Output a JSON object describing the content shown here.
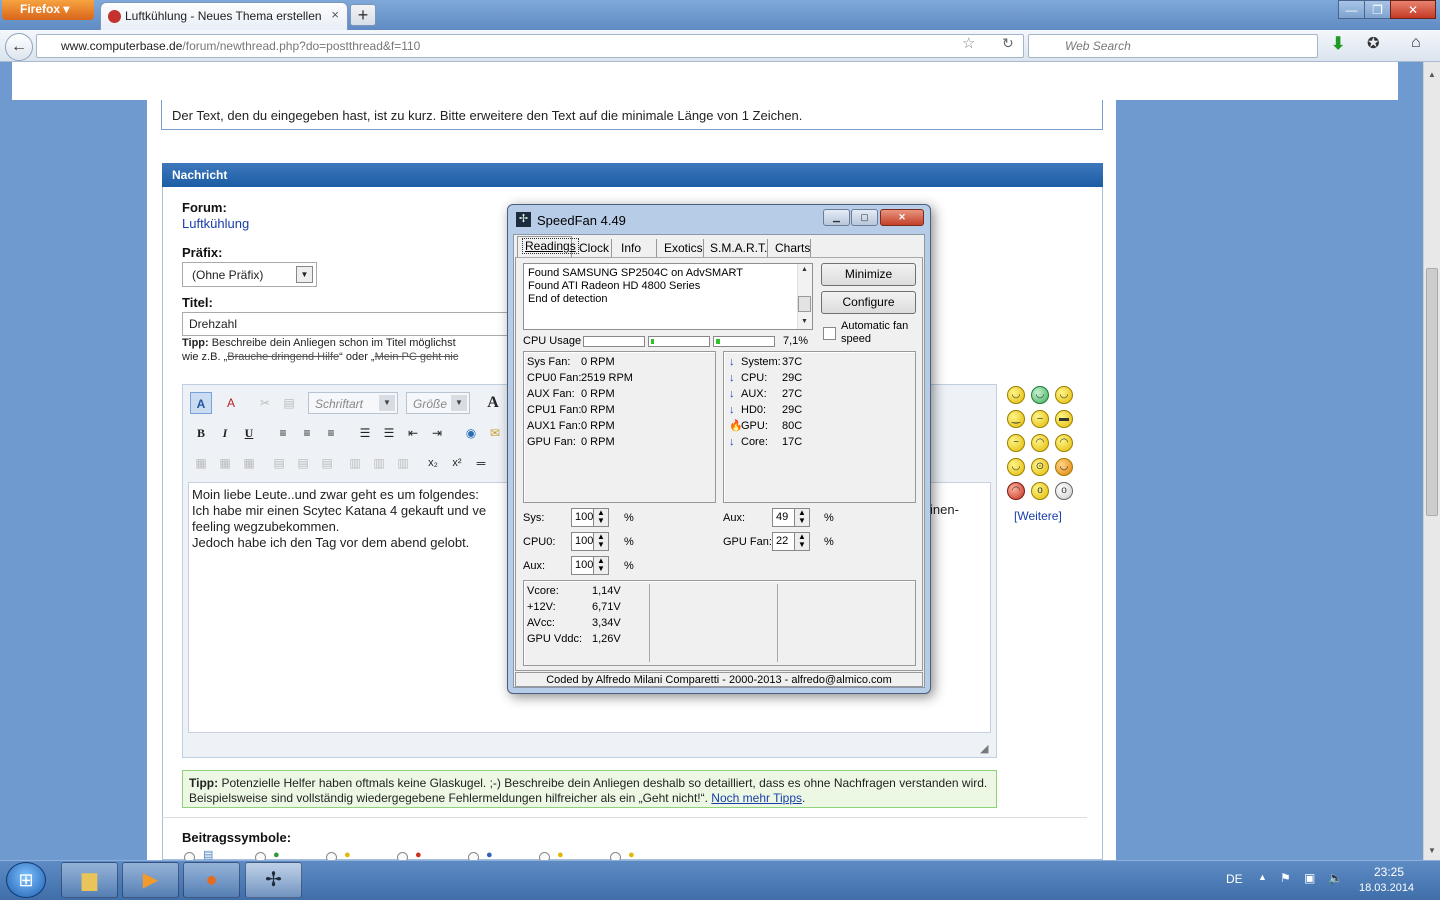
{
  "browser": {
    "menu_button": "Firefox ▾",
    "tab_title": "Luftkühlung - Neues Thema erstellen",
    "tab_close": "×",
    "new_tab": "+",
    "url_domain": "www.computerbase.de",
    "url_path": "/forum/newthread.php?do=postthread&f=110",
    "search_placeholder": "Web Search",
    "win_min": "—",
    "win_max": "❐",
    "win_close": "✕"
  },
  "page": {
    "error_text": "Der Text, den du eingegeben hast, ist zu kurz. Bitte erweitere den Text auf die minimale Länge von 1 Zeichen.",
    "section_title": "Nachricht",
    "forum_label": "Forum:",
    "forum_value": "Luftkühlung",
    "prefix_label": "Präfix:",
    "prefix_value": "(Ohne Präfix)",
    "title_label": "Titel:",
    "title_value": "Drehzahl",
    "tipp1_bold": "Tipp:",
    "tipp1_text": "Beschreibe dein Anliegen schon im Titel möglichst",
    "tipp1_line2_start": "wie z.B. „",
    "tipp1_strike1": "Brauche dringend Hilfe",
    "tipp1_mid": "“ oder „",
    "tipp1_strike2": "Mein PC geht nic",
    "font_select": "Schriftart",
    "size_select": "Größe",
    "editor_lines": [
      "Moin liebe Leute..und zwar geht es um folgendes:",
      "Ich habe mir einen Scytec Katana 4 gekauft und ve",
      "feeling wegzubekommen.",
      "Jedoch habe ich den Tag vor dem abend gelobt."
    ],
    "editor_overflow": "inen-",
    "weitere": "[Weitere]",
    "tipp2_bold": "Tipp:",
    "tipp2_text": "Potenzielle Helfer haben oftmals keine Glaskugel. ;-) Beschreibe dein Anliegen deshalb so detailliert, dass es ohne Nachfragen verstanden wird. Beispielsweise sind vollständig wiedergegebene Fehlermeldungen hilfreicher als ein „Geht nicht!“.",
    "tipp2_link": "Noch mehr Tipps",
    "tipp2_end": ".",
    "beitrag_label": "Beitragssymbole:"
  },
  "speedfan": {
    "title": "SpeedFan 4.49",
    "tabs": [
      "Readings",
      "Clock",
      "Info",
      "Exotics",
      "S.M.A.R.T.",
      "Charts"
    ],
    "log": [
      "Found SAMSUNG SP2504C on AdvSMART",
      "Found ATI Radeon HD 4800 Series",
      "End of detection"
    ],
    "btn_minimize": "Minimize",
    "btn_configure": "Configure",
    "auto_fan": "Automatic fan speed",
    "cpu_usage_label": "CPU Usage",
    "cpu_usage_value": "7,1%",
    "cpu_bars": [
      0.0,
      0.06,
      0.08
    ],
    "fans": [
      {
        "name": "Sys Fan:",
        "value": "0 RPM"
      },
      {
        "name": "CPU0 Fan:",
        "value": "2519 RPM"
      },
      {
        "name": "AUX Fan:",
        "value": "0 RPM"
      },
      {
        "name": "CPU1 Fan:",
        "value": "0 RPM"
      },
      {
        "name": "AUX1 Fan:",
        "value": "0 RPM"
      },
      {
        "name": "GPU Fan:",
        "value": "0 RPM"
      }
    ],
    "temps": [
      {
        "name": "System:",
        "value": "37C",
        "icon": "arrow-down-icon"
      },
      {
        "name": "CPU:",
        "value": "29C",
        "icon": "arrow-down-icon"
      },
      {
        "name": "AUX:",
        "value": "27C",
        "icon": "arrow-down-icon"
      },
      {
        "name": "HD0:",
        "value": "29C",
        "icon": "arrow-down-icon"
      },
      {
        "name": "GPU:",
        "value": "80C",
        "icon": "flame-icon"
      },
      {
        "name": "Core:",
        "value": "17C",
        "icon": "arrow-down-icon"
      }
    ],
    "speeds_left": [
      {
        "name": "Sys:",
        "value": "100"
      },
      {
        "name": "CPU0:",
        "value": "100"
      },
      {
        "name": "Aux:",
        "value": "100"
      }
    ],
    "speeds_right": [
      {
        "name": "Aux:",
        "value": "49"
      },
      {
        "name": "GPU Fan:",
        "value": "22"
      }
    ],
    "percent": "%",
    "voltages": [
      {
        "name": "Vcore:",
        "value": "1,14V"
      },
      {
        "name": "+12V:",
        "value": "6,71V"
      },
      {
        "name": "AVcc:",
        "value": "3,34V"
      },
      {
        "name": "GPU Vddc:",
        "value": "1,26V"
      }
    ],
    "credit": "Coded by Alfredo Milani Comparetti - 2000-2013 - alfredo@almico.com"
  },
  "taskbar": {
    "lang": "DE",
    "time": "23:25",
    "date": "18.03.2014"
  }
}
